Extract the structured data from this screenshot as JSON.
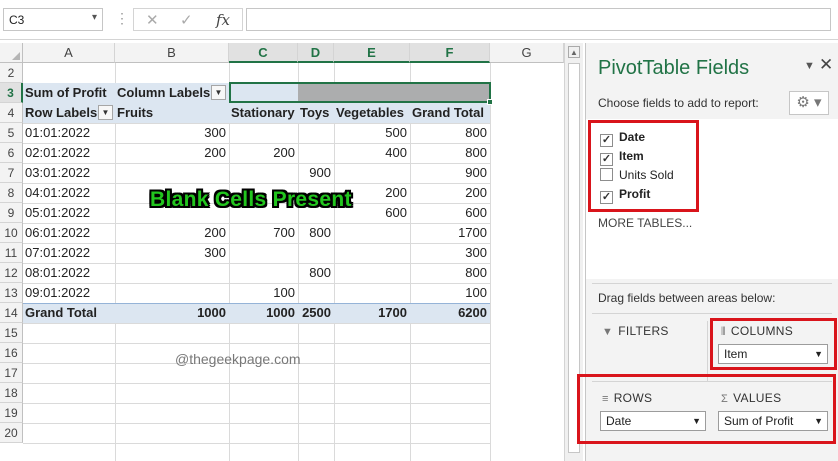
{
  "formula_bar": {
    "name_box": "C3",
    "separator": "⋮",
    "cancel_icon": "✕",
    "enter_icon": "✓",
    "fx_label": "fx",
    "formula": ""
  },
  "columns": [
    "A",
    "B",
    "C",
    "D",
    "E",
    "F",
    "G"
  ],
  "rows": [
    "2",
    "3",
    "4",
    "5",
    "6",
    "7",
    "8",
    "9",
    "10",
    "11",
    "12",
    "13",
    "14",
    "15",
    "16",
    "17",
    "18",
    "19",
    "20"
  ],
  "pivot": {
    "sum_label": "Sum of Profit",
    "column_labels": "Column Labels",
    "row_labels": "Row Labels",
    "headers": [
      "Fruits",
      "Stationary",
      "Toys",
      "Vegetables",
      "Grand Total"
    ],
    "rows": [
      {
        "label": "01:01:2022",
        "values": [
          "300",
          "",
          "",
          "500",
          "800"
        ]
      },
      {
        "label": "02:01:2022",
        "values": [
          "200",
          "200",
          "",
          "400",
          "800"
        ]
      },
      {
        "label": "03:01:2022",
        "values": [
          "",
          "",
          "900",
          "",
          "900"
        ]
      },
      {
        "label": "04:01:2022",
        "values": [
          "",
          "",
          "",
          "200",
          "200"
        ]
      },
      {
        "label": "05:01:2022",
        "values": [
          "",
          "",
          "",
          "600",
          "600"
        ]
      },
      {
        "label": "06:01:2022",
        "values": [
          "200",
          "700",
          "800",
          "",
          "1700"
        ]
      },
      {
        "label": "07:01:2022",
        "values": [
          "300",
          "",
          "",
          "",
          "300"
        ]
      },
      {
        "label": "08:01:2022",
        "values": [
          "",
          "",
          "800",
          "",
          "800"
        ]
      },
      {
        "label": "09:01:2022",
        "values": [
          "",
          "100",
          "",
          "",
          "100"
        ]
      }
    ],
    "grand_total": {
      "label": "Grand Total",
      "values": [
        "1000",
        "1000",
        "2500",
        "1700",
        "6200"
      ]
    }
  },
  "annotation": "Blank Cells Present",
  "watermark": "@thegeekpage.com",
  "pane": {
    "title": "PivotTable Fields",
    "menu_icon": "▼",
    "close_icon": "✕",
    "choose_label": "Choose fields to add to report:",
    "gear_icon": "⚙ ▾",
    "fields": [
      {
        "name": "Date",
        "checked": true
      },
      {
        "name": "Item",
        "checked": true
      },
      {
        "name": "Units Sold",
        "checked": false
      },
      {
        "name": "Profit",
        "checked": true
      }
    ],
    "more_tables": "MORE TABLES...",
    "drag_label": "Drag fields between areas below:",
    "filters_label": "FILTERS",
    "columns_label": "COLUMNS",
    "columns_value": "Item",
    "rows_label": "ROWS",
    "rows_value": "Date",
    "values_label": "VALUES",
    "values_value": "Sum of Profit"
  },
  "colors": {
    "accent": "#217346",
    "highlight_box": "#d9141b",
    "annotation_text": "#22c51e",
    "pivot_band": "#dce6f1"
  }
}
